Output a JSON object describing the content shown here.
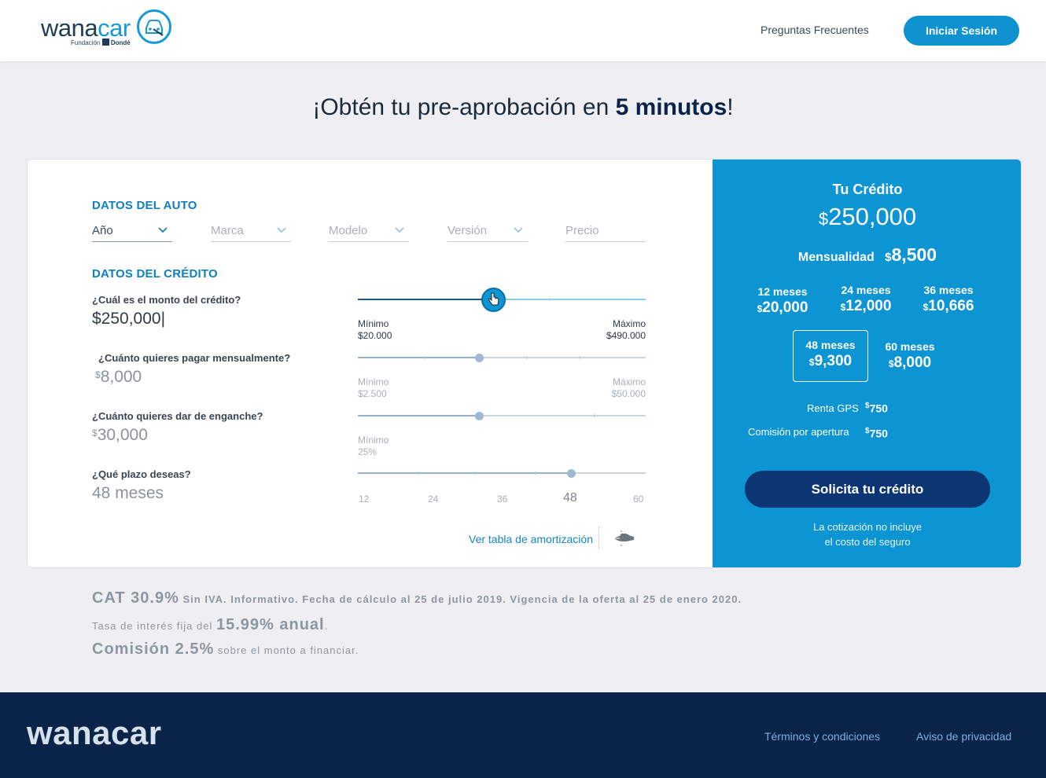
{
  "header": {
    "logo_main": "wana",
    "logo_accent": "car",
    "logo_sub_prefix": "Fundación",
    "logo_sub_brand": "Dondé",
    "faq_link": "Preguntas Frecuentes",
    "login_button": "Iniciar Sesión"
  },
  "hero": {
    "prefix": "¡Obtén tu pre-aprobación en ",
    "bold": "5 minutos",
    "suffix": "!"
  },
  "car_section": {
    "title": "DATOS DEL AUTO",
    "fields": [
      "Año",
      "Marca",
      "Modelo",
      "Versión",
      "Precio"
    ]
  },
  "credit_section": {
    "title": "DATOS DEL CRÉDITO",
    "amount_question": "¿Cuál es el monto del crédito?",
    "amount_value": "$250,000|",
    "amount_min_label": "Mínimo",
    "amount_min_value": "$20.000",
    "amount_max_label": "Máximo",
    "amount_max_value": "$490.000",
    "amount_progress": 0.47,
    "monthly_question": "¿Cuánto quieres pagar mensualmente?",
    "monthly_currency": "$",
    "monthly_value": "8,000",
    "monthly_min_label": "Mínimo",
    "monthly_min_value": "$2.500",
    "monthly_max_label": "Máximo",
    "monthly_max_value": "$50.000",
    "monthly_progress": 0.42,
    "down_question": "¿Cuánto quieres dar de enganche?",
    "down_currency": "$",
    "down_value": "30,000",
    "down_min_label": "Mínimo",
    "down_min_value": "25%",
    "down_progress": 0.42,
    "term_question": "¿Qué plazo deseas?",
    "term_value": "48 meses",
    "term_options": [
      "12",
      "24",
      "36",
      "48",
      "60"
    ],
    "term_progress": 0.74,
    "amortization_link": "Ver tabla de amortización"
  },
  "summary": {
    "title": "Tu Crédito",
    "currency": "$",
    "amount": "250,000",
    "monthly_label": "Mensualidad",
    "monthly_value": "8,500",
    "terms": [
      {
        "months": "12 meses",
        "value": "20,000"
      },
      {
        "months": "24 meses",
        "value": "12,000"
      },
      {
        "months": "36 meses",
        "value": "10,666"
      },
      {
        "months": "48 meses",
        "value": "9,300"
      },
      {
        "months": "60 meses",
        "value": "8,000"
      }
    ],
    "gps_label": "Renta GPS",
    "gps_value": "750",
    "commission_label": "Comisión por apertura",
    "commission_value": "750",
    "apply_button": "Solicita tu crédito",
    "note_line1": "La cotización no incluye",
    "note_line2": "el costo del seguro"
  },
  "disclaimer": {
    "cat_big": "CAT 30.9%",
    "cat_text": " Sin IVA. Informativo. Fecha de cálculo al 25 de julio 2019. Vigencia de la oferta al 25 de enero 2020.",
    "rate_prefix": "Tasa de interés fija del ",
    "rate_big": "15.99% anual",
    "rate_suffix": ".",
    "commission_big": "Comisión 2.5%",
    "commission_text": " sobre el monto a financiar."
  },
  "footer": {
    "logo": "wanacar",
    "terms_link": "Términos y condiciones",
    "privacy_link": "Aviso de privacidad"
  },
  "colors": {
    "brand_blue": "#0d94d3",
    "navy": "#0a2349",
    "button_navy": "#0c3574"
  }
}
